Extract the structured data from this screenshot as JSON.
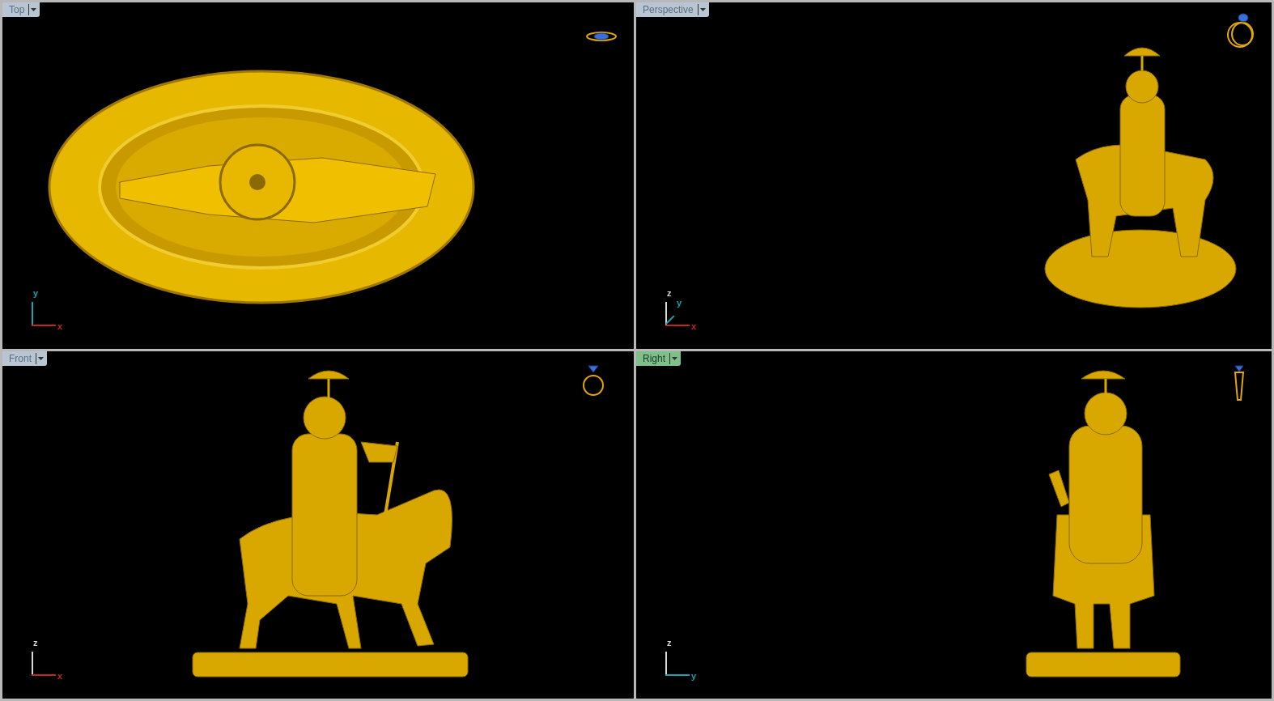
{
  "viewports": [
    {
      "title": "Top",
      "selected": false,
      "kind": "top",
      "axes": [
        {
          "kind": "vertical",
          "label": "y",
          "color": "#1aa3b0"
        },
        {
          "kind": "horizontal",
          "label": "x",
          "color": "#c0281c"
        }
      ]
    },
    {
      "title": "Perspective",
      "selected": false,
      "kind": "perspective",
      "axes": [
        {
          "kind": "vertical",
          "label": "z",
          "color": "#d8d8d8"
        },
        {
          "kind": "depth",
          "label": "y",
          "color": "#1aa3b0"
        },
        {
          "kind": "horizontal",
          "label": "x",
          "color": "#c0281c"
        }
      ]
    },
    {
      "title": "Front",
      "selected": false,
      "kind": "front",
      "axes": [
        {
          "kind": "vertical",
          "label": "z",
          "color": "#d8d8d8"
        },
        {
          "kind": "horizontal",
          "label": "x",
          "color": "#c0281c"
        }
      ]
    },
    {
      "title": "Right",
      "selected": true,
      "kind": "right",
      "axes": [
        {
          "kind": "vertical",
          "label": "z",
          "color": "#d8d8d8"
        },
        {
          "kind": "horizontal",
          "label": "y",
          "color": "#1aa3b0"
        }
      ]
    }
  ]
}
